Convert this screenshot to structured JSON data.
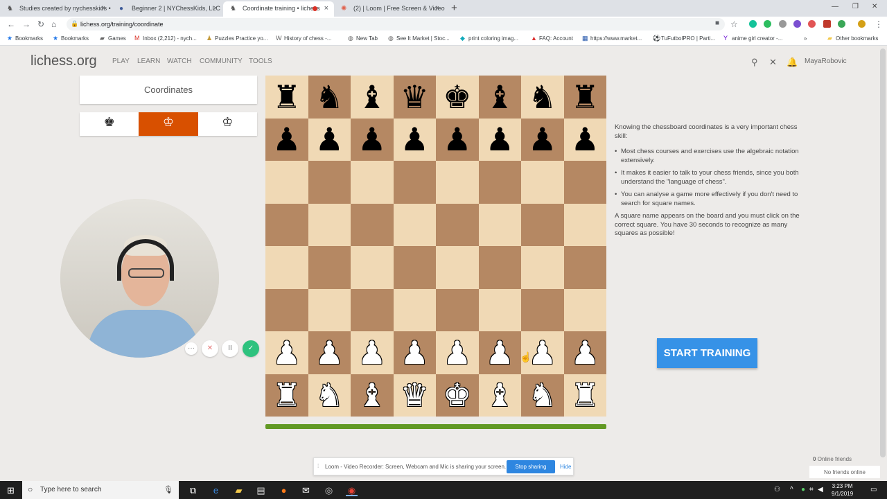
{
  "browser": {
    "tabs": [
      {
        "title": "Studies created by nychesskids •",
        "icon": "lichess-icon",
        "active": false
      },
      {
        "title": "Beginner 2 | NYChessKids, LLC",
        "icon": "facebook-icon",
        "active": false
      },
      {
        "title": "Coordinate training • lichess",
        "icon": "lichess-icon",
        "active": true
      },
      {
        "title": "(2) | Loom | Free Screen & Video",
        "icon": "loom-icon",
        "active": false
      }
    ],
    "new_tab": "+",
    "url": "lichess.org/training/coordinate",
    "bookmarks": [
      "Bookmarks",
      "Bookmarks",
      "Games",
      "Inbox (2,212) - nych...",
      "Puzzles Practice yo...",
      "History of chess -...",
      "New Tab",
      "See It Market | Stoc...",
      "print coloring imag...",
      "FAQ: Account",
      "https://www.market...",
      "TuFutbolPRO | Parti...",
      "anime girl creator -...",
      "»",
      "Other bookmarks"
    ]
  },
  "site": {
    "logo": "lichess.org",
    "nav": [
      "PLAY",
      "LEARN",
      "WATCH",
      "COMMUNITY",
      "TOOLS"
    ],
    "username": "MayaRobovic"
  },
  "side": {
    "title": "Coordinates",
    "color_options": [
      "♚",
      "♔",
      "♔"
    ],
    "selected_color": 1
  },
  "board": {
    "rows": [
      [
        "r",
        "n",
        "b",
        "q",
        "k",
        "b",
        "n",
        "r"
      ],
      [
        "p",
        "p",
        "p",
        "p",
        "p",
        "p",
        "p",
        "p"
      ],
      [
        "",
        "",
        "",
        "",
        "",
        "",
        "",
        ""
      ],
      [
        "",
        "",
        "",
        "",
        "",
        "",
        "",
        ""
      ],
      [
        "",
        "",
        "",
        "",
        "",
        "",
        "",
        ""
      ],
      [
        "",
        "",
        "",
        "",
        "",
        "",
        "",
        ""
      ],
      [
        "P",
        "P",
        "P",
        "P",
        "P",
        "P",
        "P",
        "P"
      ],
      [
        "R",
        "N",
        "B",
        "Q",
        "K",
        "B",
        "N",
        "R"
      ]
    ],
    "timer_fraction": 1.0,
    "colors": {
      "light": "#f0d9b5",
      "dark": "#b58863"
    }
  },
  "info": {
    "intro": "Knowing the chessboard coordinates is a very important chess skill:",
    "bullets": [
      "Most chess courses and exercises use the algebraic notation extensively.",
      "It makes it easier to talk to your chess friends, since you both understand the \"language of chess\".",
      "You can analyse a game more effectively if you don't need to search for square names."
    ],
    "outro": "A square name appears on the board and you must click on the correct square. You have 30 seconds to recognize as many squares as possible!",
    "start_label": "START TRAINING"
  },
  "loom": {
    "message": "Loom - Video Recorder: Screen, Webcam and Mic is sharing your screen.",
    "stop_label": "Stop sharing",
    "hide_label": "Hide",
    "controls": [
      "···",
      "✕",
      "II",
      "✓"
    ]
  },
  "friends": {
    "count": "0",
    "count_label": "Online friends",
    "none_label": "No friends online"
  },
  "taskbar": {
    "search_placeholder": "Type here to search",
    "time": "3:23 PM",
    "date": "9/1/2019"
  }
}
